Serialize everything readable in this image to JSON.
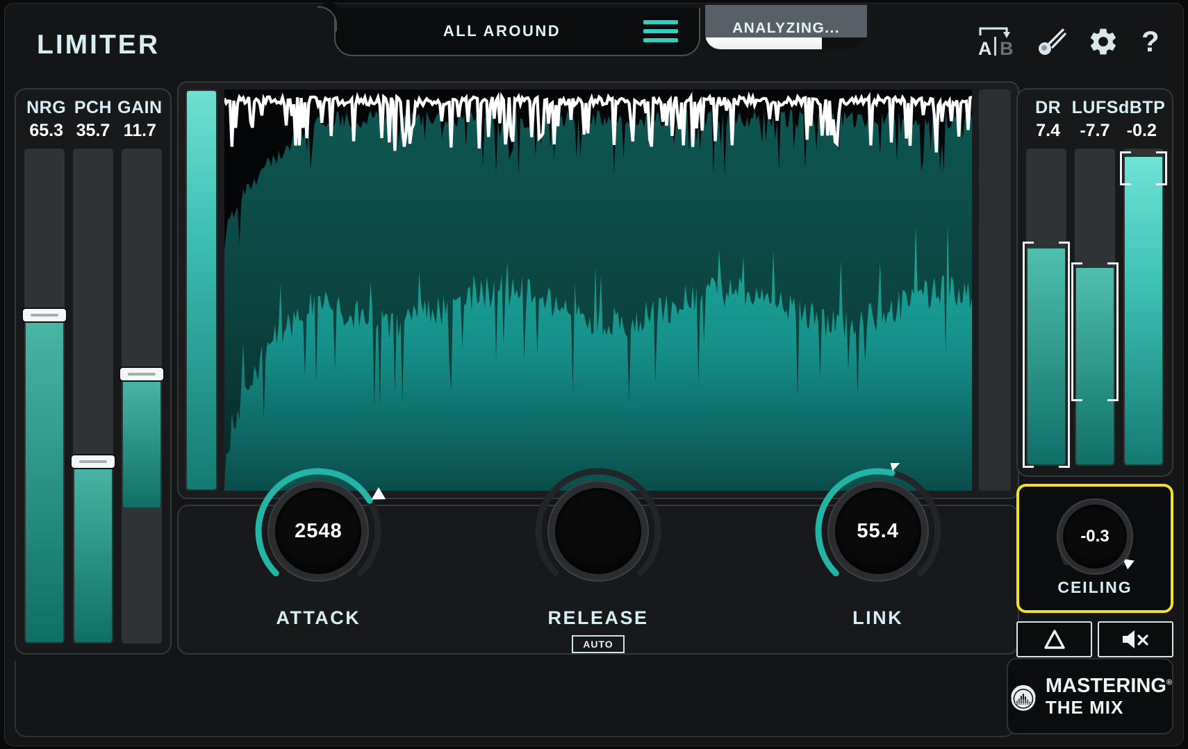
{
  "header": {
    "plugin_title": "LIMITER",
    "preset_name": "ALL AROUND",
    "preset_menu_icon": "hamburger-menu-icon",
    "analyzing_label": "ANALYZING...",
    "analyzing_progress_percent": 72,
    "icons": {
      "ab_compare": "a-b-compare-icon",
      "ab_a_letter": "A",
      "ab_b_letter": "B",
      "magic_wand": "magic-wand-icon",
      "settings": "gear-icon",
      "help": "?"
    }
  },
  "left_meters": {
    "columns": [
      {
        "label": "NRG",
        "value": "65.3",
        "fill_percent": 65.3,
        "handle_percent": 65.3
      },
      {
        "label": "PCH",
        "value": "35.7",
        "fill_percent": 35.7,
        "handle_percent": 35.7
      },
      {
        "label": "GAIN",
        "value": "11.7",
        "fill_percent": 26.0,
        "handle_percent": 53.5,
        "floating": true
      }
    ]
  },
  "right_meters": {
    "columns": [
      {
        "label": "DR",
        "value": "7.4",
        "fill_percent": 68.0,
        "bracket_top_percent": 70.0,
        "bracket_bottom_percent": 0.0,
        "bright": false
      },
      {
        "label": "LUFS",
        "value": "-7.7",
        "fill_percent": 62.0,
        "bracket_top_percent": 63.5,
        "bracket_bottom_percent": 21.0,
        "bright": false
      },
      {
        "label": "dBTP",
        "value": "-0.2",
        "fill_percent": 97.0,
        "bracket_top_percent": 98.5,
        "bracket_bottom_percent": 89.0,
        "bright": true
      }
    ]
  },
  "knobs": [
    {
      "name": "ATTACK",
      "value": "2548",
      "arc_percent": 72,
      "auto": false,
      "auto_label": ""
    },
    {
      "name": "RELEASE",
      "value": "",
      "arc_percent": 0,
      "auto": true,
      "auto_label": "AUTO"
    },
    {
      "name": "LINK",
      "value": "55.4",
      "arc_percent": 55,
      "auto": false,
      "auto_label": ""
    }
  ],
  "ceiling": {
    "label": "CEILING",
    "value": "-0.3",
    "arc_percent": 97,
    "highlighted": true,
    "highlight_color": "#f5e31a",
    "buttons": [
      {
        "icon": "delta-difference-icon",
        "name": "delta-listen-button"
      },
      {
        "icon": "speaker-mute-icon",
        "name": "mute-button"
      }
    ]
  },
  "waveform": {
    "gain_reduction_meter_fill_percent": 100,
    "right_meter_fill_percent": 0,
    "peak_line_color": "#ffffff",
    "peak_envelope_color": "#0d4f4c",
    "rms_envelope_color": "#17a094"
  },
  "brand": {
    "line1": "MASTERING",
    "line2": "THE MIX",
    "registered": "®",
    "logo_icon": "headphones-equalizer-logo"
  },
  "colors": {
    "accent_teal": "#2fd2c2",
    "panel_bg": "#17191b",
    "text_light": "#d7eff4",
    "highlight_yellow": "#f5e31a"
  }
}
